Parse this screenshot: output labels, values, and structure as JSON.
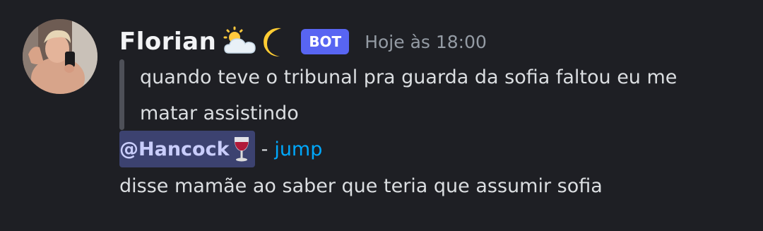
{
  "message": {
    "author": {
      "name": "Florian",
      "status_emoji": [
        "sun-behind-cloud-icon",
        "crescent-moon-icon"
      ],
      "bot_tag": "BOT"
    },
    "timestamp": "Hoje às 18:00",
    "quote": {
      "text": "quando teve o tribunal pra guarda da sofia faltou eu me matar assistindo"
    },
    "reference": {
      "mention": "@Hancock",
      "mention_emoji": "wine-glass-icon",
      "separator": "-",
      "link_text": "jump"
    },
    "body": "disse mamãe ao saber que teria que assumir sofia"
  },
  "colors": {
    "background": "#1e1f24",
    "bot_tag": "#5865f2",
    "mention_bg": "#3c4270",
    "link": "#00a8fc"
  }
}
